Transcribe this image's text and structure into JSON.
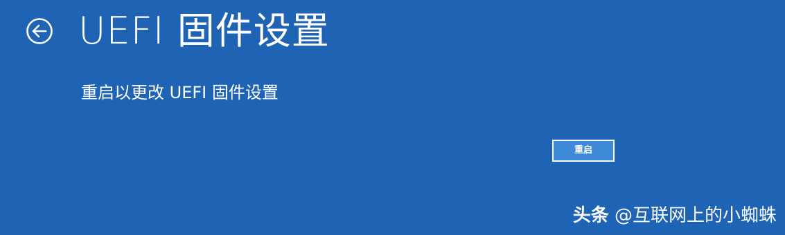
{
  "header": {
    "title": "UEFI 固件设置",
    "back_icon": "back-arrow-circle-icon"
  },
  "main": {
    "description": "重启以更改 UEFI 固件设置",
    "restart_label": "重启"
  },
  "watermark": {
    "brand": "头条",
    "handle": "@互联网上的小蜘蛛"
  },
  "colors": {
    "background": "#1f63b4",
    "button_background": "#3f8ad8",
    "text": "#ffffff"
  }
}
